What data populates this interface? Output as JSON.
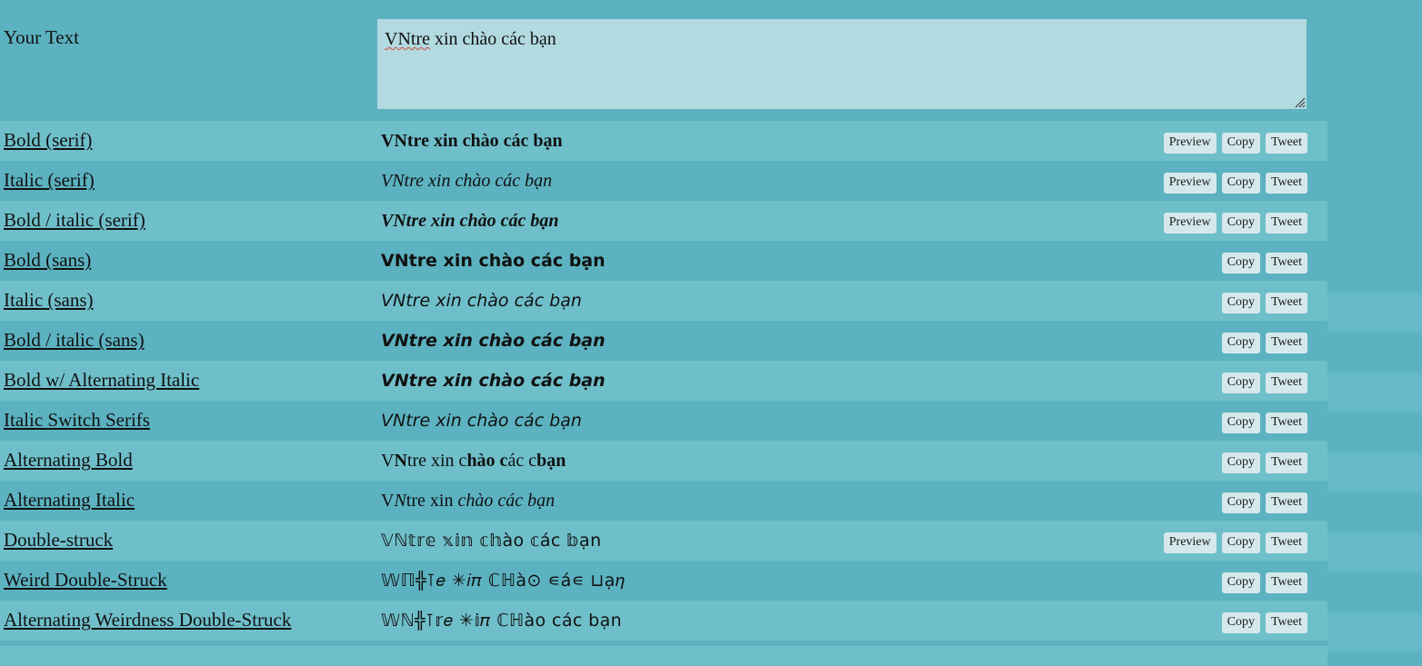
{
  "colors": {
    "page_background": "#5cb2c0",
    "row_odd": "#5cb2c0",
    "row_even": "#6fbfca",
    "textarea_background": "#b2dae0",
    "button_background": "#d5e9ec",
    "text": "#111111",
    "spellcheck_underline": "#d04a3a"
  },
  "input_row": {
    "label": "Your Text",
    "textarea": {
      "value": "VNtre xin chào các bạn",
      "misspelled_word": "VNtre",
      "rest_of_value": " xin chào các bạn",
      "placeholder": "",
      "resize_handle": "resize-grip-icon"
    }
  },
  "buttons": {
    "preview": "Preview",
    "copy": "Copy",
    "tweet": "Tweet"
  },
  "rows": [
    {
      "label": "Bold (serif)",
      "output": "VNtre xin chào các bạn",
      "has_preview": true,
      "style_class": "s-bold-serif"
    },
    {
      "label": "Italic (serif)",
      "output": "VNtre xin chào các bạn",
      "has_preview": true,
      "style_class": "s-italic-serif"
    },
    {
      "label": "Bold / italic (serif)",
      "output": "VNtre xin chào các bạn",
      "has_preview": true,
      "style_class": "s-bi-serif"
    },
    {
      "label": "Bold (sans)",
      "output": "VNtre xin chào các bạn",
      "has_preview": false,
      "style_class": "s-bold-sans"
    },
    {
      "label": "Italic (sans)",
      "output": "VNtre xin chào các bạn",
      "has_preview": false,
      "style_class": "s-italic-sans"
    },
    {
      "label": "Bold / italic (sans)",
      "output": "VNtre xin chào các bạn",
      "has_preview": false,
      "style_class": "s-bi-sans"
    },
    {
      "label": "Bold w/ Alternating Italic",
      "output": "VNtre xin chào các bạn",
      "has_preview": false,
      "style_class": "s-bold-alt-it"
    },
    {
      "label": "Italic Switch Serifs",
      "output": "VNtre xin chào các bạn",
      "has_preview": false,
      "style_class": "s-it-switch"
    },
    {
      "label": "Alternating Bold",
      "output": "VNtre xin chào các bạn",
      "has_preview": false,
      "style_class": "s-alt-bold",
      "segments": [
        {
          "text": "V",
          "bold": false
        },
        {
          "text": "N",
          "bold": true
        },
        {
          "text": "tre xin c",
          "bold": false
        },
        {
          "text": "hào c",
          "bold": true
        },
        {
          "text": "ác c",
          "bold": false
        },
        {
          "text": "bạn",
          "bold": true
        }
      ]
    },
    {
      "label": "Alternating Italic",
      "output": "VNtre xin chào các bạn",
      "has_preview": false,
      "style_class": "s-alt-italic",
      "segments": [
        {
          "text": "V",
          "italic": false
        },
        {
          "text": "N",
          "italic": true
        },
        {
          "text": "tre xin ",
          "italic": false
        },
        {
          "text": "chào các bạn",
          "italic": true
        }
      ]
    },
    {
      "label": "Double-struck",
      "output": "𝕍ℕ𝕥𝕣𝕖 𝕩𝕚𝕟 𝕔𝕙ào 𝕔ác 𝕓ạn",
      "has_preview": true,
      "style_class": "s-dstruck"
    },
    {
      "label": "Weird Double-Struck",
      "output": "𝕎ℿ╬⊺𝑒 ✳𝑖𝜋 ℂℍà⊙ ∊á∊ ⊔ạ𝜂",
      "has_preview": false,
      "style_class": "s-weird"
    },
    {
      "label": "Alternating Weirdness Double-Struck",
      "output": "𝕎ℕ╬⊺𝕣𝑒 ✳𝕚𝜋 ℂℍào các bạn",
      "has_preview": false,
      "style_class": "s-altweird"
    }
  ]
}
